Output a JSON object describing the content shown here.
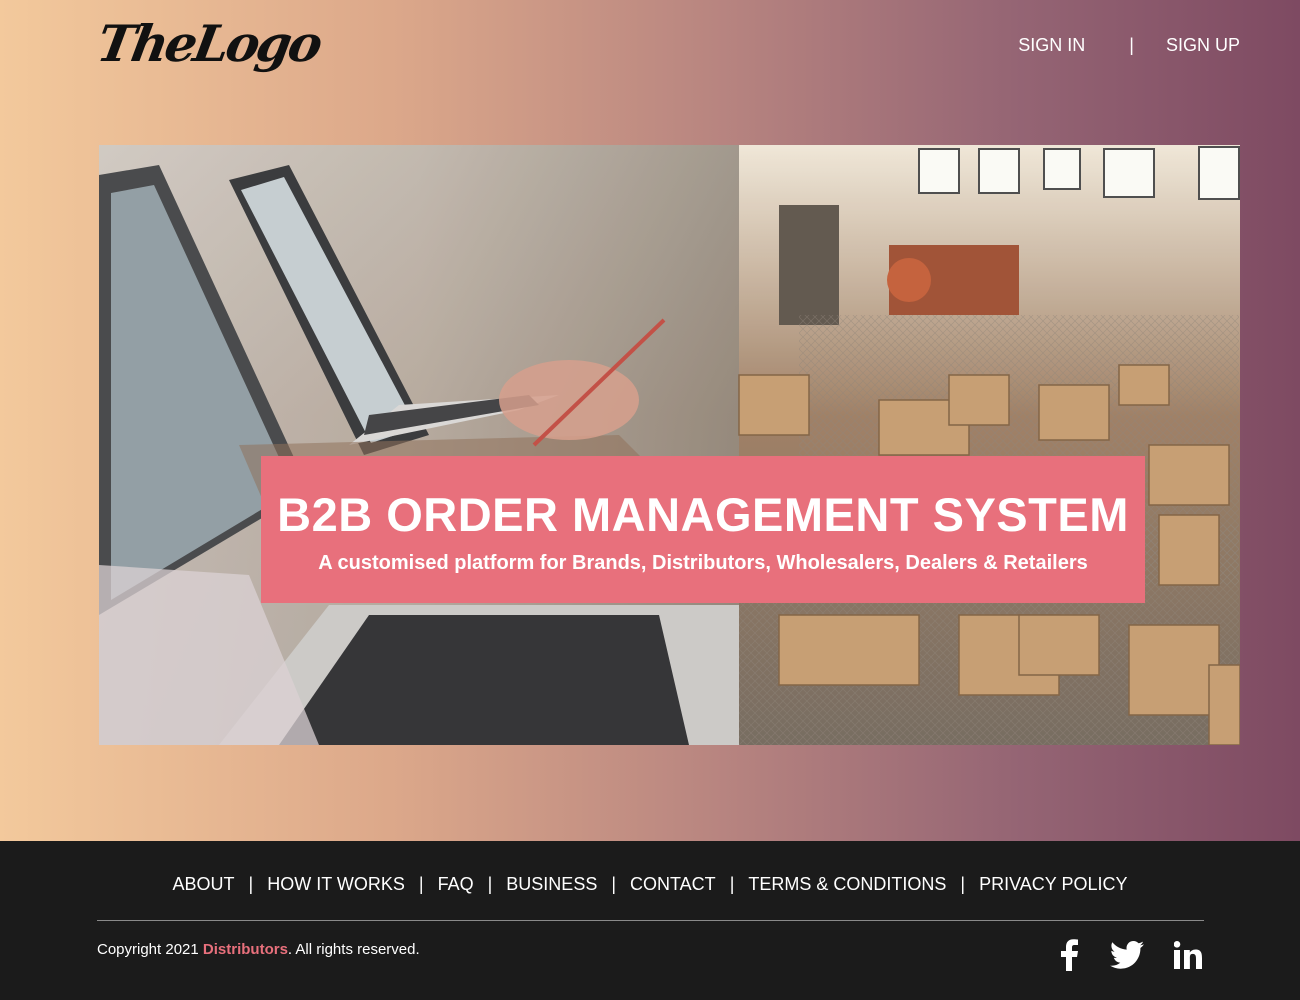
{
  "header": {
    "logo_text": "TheLogo",
    "sign_in": "SIGN IN",
    "separator": "|",
    "sign_up": "SIGN UP"
  },
  "hero": {
    "title": "B2B ORDER MANAGEMENT SYSTEM",
    "subtitle": "A customised platform for Brands, Distributors, Wholesalers, Dealers & Retailers"
  },
  "footer": {
    "nav": [
      "ABOUT",
      "HOW IT WORKS",
      "FAQ",
      "BUSINESS",
      "CONTACT",
      "TERMS & CONDITIONS",
      "PRIVACY POLICY"
    ],
    "nav_separator": "|",
    "copyright_prefix": "Copyright 2021 ",
    "copyright_brand": "Distributors",
    "copyright_suffix": ". All rights reserved.",
    "social_icons": [
      "facebook-icon",
      "twitter-icon",
      "linkedin-icon"
    ]
  },
  "colors": {
    "accent": "#e8707c",
    "footer_bg": "#1b1b1b",
    "gradient_start": "#f3c99c",
    "gradient_end": "#7e4a62"
  }
}
